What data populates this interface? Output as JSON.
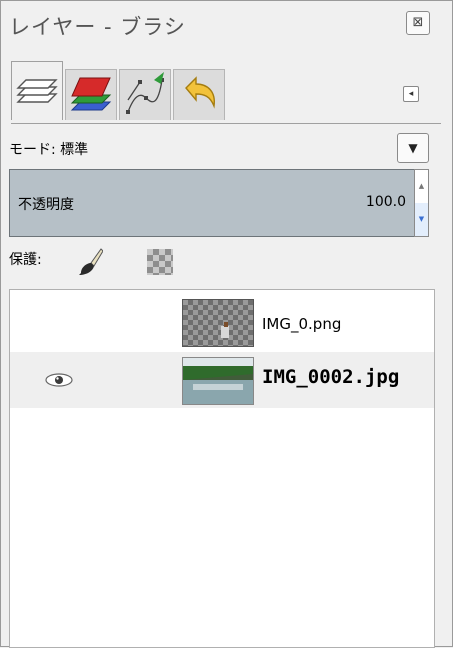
{
  "dialog": {
    "title": "レイヤー - ブラシ",
    "close_symbol": "⊠"
  },
  "tabs": [
    {
      "name": "layers",
      "icon": "layers-icon"
    },
    {
      "name": "channels",
      "icon": "channels-icon"
    },
    {
      "name": "paths",
      "icon": "paths-icon"
    },
    {
      "name": "undo-history",
      "icon": "undo-icon"
    }
  ],
  "panel_menu_symbol": "◂",
  "mode": {
    "label": "モード: 標準",
    "dropdown_symbol": "▼"
  },
  "opacity": {
    "label": "不透明度",
    "value": "100.0",
    "up": "▲",
    "down": "▼"
  },
  "protect": {
    "label": "保護:"
  },
  "layers": [
    {
      "name": "IMG_0.png",
      "visible": false,
      "selected": false
    },
    {
      "name": "IMG_0002.jpg",
      "visible": true,
      "selected": true
    }
  ],
  "colors": {
    "accent": "#3a6fd2",
    "opacity_bar": "#b6c0c7",
    "selection_row": "#efefef"
  }
}
